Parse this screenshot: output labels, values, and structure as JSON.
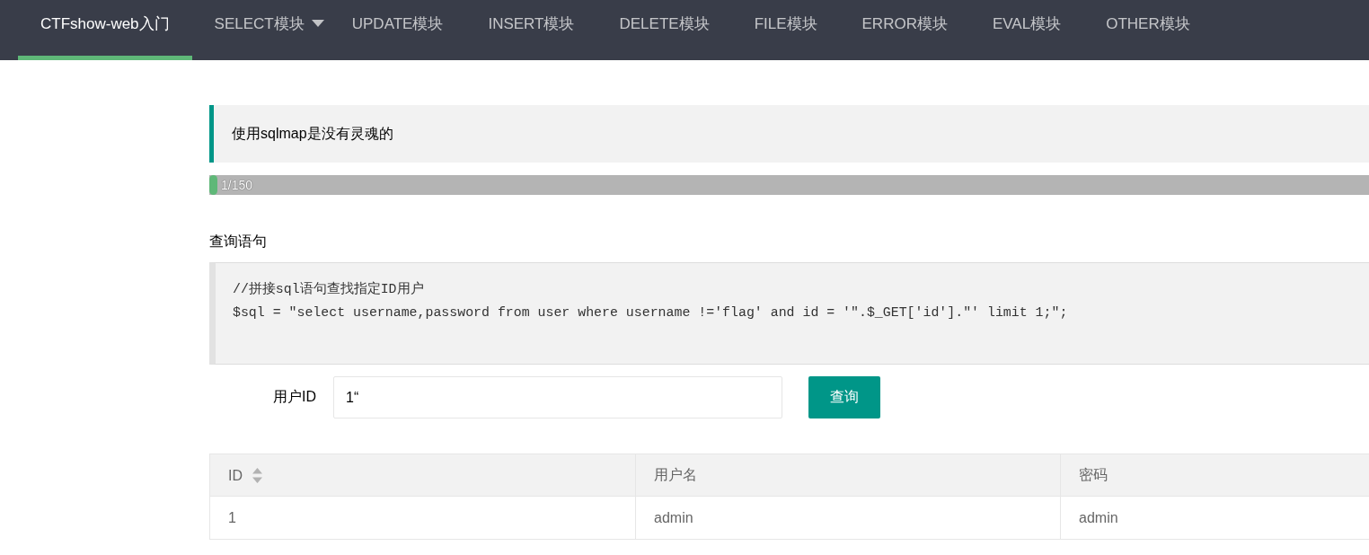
{
  "nav": {
    "items": [
      {
        "label": "CTFshow-web入门",
        "selected": true,
        "dropdown": false
      },
      {
        "label": "SELECT模块",
        "selected": false,
        "dropdown": true
      },
      {
        "label": "UPDATE模块",
        "selected": false,
        "dropdown": false
      },
      {
        "label": "INSERT模块",
        "selected": false,
        "dropdown": false
      },
      {
        "label": "DELETE模块",
        "selected": false,
        "dropdown": false
      },
      {
        "label": "FILE模块",
        "selected": false,
        "dropdown": false
      },
      {
        "label": "ERROR模块",
        "selected": false,
        "dropdown": false
      },
      {
        "label": "EVAL模块",
        "selected": false,
        "dropdown": false
      },
      {
        "label": "OTHER模块",
        "selected": false,
        "dropdown": false
      }
    ]
  },
  "notice": {
    "text": "使用sqlmap是没有灵魂的"
  },
  "progress": {
    "level": 0.0067,
    "text": "1/150"
  },
  "query": {
    "heading": "查询语句",
    "code_lines": [
      "//拼接sql语句查找指定ID用户",
      "$sql = \"select username,password from user where username !='flag' and id = '\".$_GET['id'].\"' limit 1;\";"
    ]
  },
  "form": {
    "label": "用户ID",
    "value": "1“",
    "button": "查询"
  },
  "table": {
    "columns": [
      {
        "label": "ID",
        "sortable": true
      },
      {
        "label": "用户名",
        "sortable": false
      },
      {
        "label": "密码",
        "sortable": false
      }
    ],
    "rows": [
      [
        "1",
        "admin",
        "admin"
      ]
    ]
  }
}
